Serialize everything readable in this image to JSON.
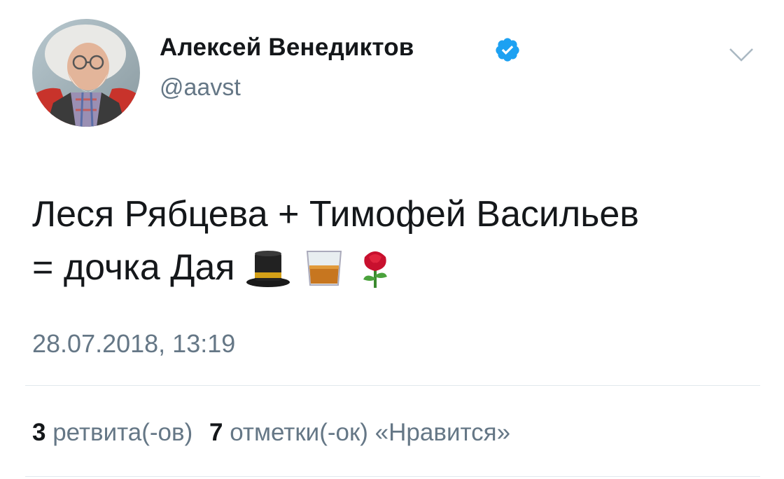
{
  "author": {
    "name": "Алексей Венедиктов",
    "handle": "@aavst",
    "verified": true
  },
  "tweet": {
    "text_line1": "Леся Рябцева + Тимофей Васильев",
    "text_line2": "= дочка Дая",
    "emojis": [
      "top-hat-icon",
      "tumbler-glass-icon",
      "rose-icon"
    ],
    "timestamp": "28.07.2018, 13:19"
  },
  "stats": {
    "retweets_count": "3",
    "retweets_label": "ретвита(-ов)",
    "likes_count": "7",
    "likes_label": "отметки(-ок) «Нравится»"
  },
  "colors": {
    "text": "#14171a",
    "secondary": "#657786",
    "verified": "#1da1f2",
    "divider": "#e1e8ed"
  }
}
